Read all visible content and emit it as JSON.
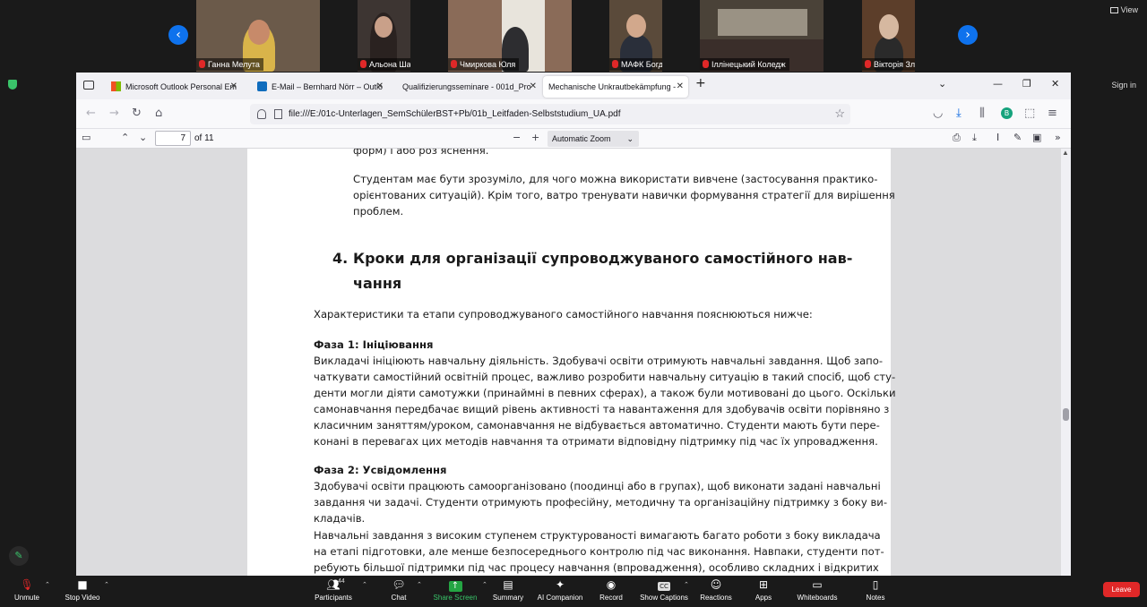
{
  "view_label": "View",
  "sign_in_label": "Sign in",
  "participants_strip": [
    {
      "name": "Ганна Мелута"
    },
    {
      "name": "Альона Шаповал"
    },
    {
      "name": "Чмиркова Юля"
    },
    {
      "name": "МАФК Богдан Борчук"
    },
    {
      "name": "Іллінецький Коледж"
    },
    {
      "name": "Вікторія Зленко"
    }
  ],
  "browser": {
    "tabs": [
      {
        "label": "Microsoft Outlook Personal Em"
      },
      {
        "label": "E-Mail – Bernhard Nörr – Outlo"
      },
      {
        "label": "Qualifizierungsseminare - 001d_Pro"
      },
      {
        "label": "Mechanische Unkrautbekämpfung -"
      }
    ],
    "url": "file:///E:/01c-Unterlagen_SemSchülerBST+Pb/01b_Leitfaden-Selbststudium_UA.pdf"
  },
  "pdf_toolbar": {
    "page_value": "7",
    "page_total": "of 11",
    "zoom": "Automatic Zoom"
  },
  "document": {
    "cut_top_line": "форм) і або роз’яснення.",
    "intro_para": [
      "Студентам має бути зрозуміло, для чого можна використати вивчене (застосування практико-",
      "орієнтованих ситуацій). Крім того, ватро тренувати навички формування стратегії для вирішення",
      "проблем."
    ],
    "heading_num": "4.",
    "heading_lines": [
      "Кроки для організації супроводжуваного самостійного нав-",
      "чання"
    ],
    "lead": "Характеристики та етапи супроводжуваного самостійного навчання пояснюються нижче:",
    "phase1_title": "Фаза 1: Ініціювання",
    "phase1_lines": [
      "Викладачі ініціюють навчальну діяльність. Здобувачі освіти отримують навчальні завдання. Щоб запо-",
      "чаткувати самостійний освітній процес, важливо розробити навчальну ситуацію в такий спосіб, щоб сту-",
      "денти могли діяти самотужки (принаймні в певних сферах), а також були мотивовані до цього. Оскільки",
      "самонавчання передбачає вищий рівень активності та навантаження для здобувачів освіти порівняно з",
      "класичним заняттям/уроком, самонавчання не відбувається автоматично. Студенти мають бути пере-",
      "конані в перевагах цих методів навчання та отримати відповідну підтримку під час їх упровадження."
    ],
    "phase2_title": "Фаза 2: Усвідомлення",
    "phase2_lines": [
      "Здобувачі освіти працюють самоорганізовано (поодинці або в групах), щоб виконати задані навчальні",
      "завдання чи задачі. Студенти отримують професійну, методичну та організаційну підтримку з боку ви-",
      "кладачів."
    ],
    "last_lines": [
      "Навчальні завдання з високим ступенем структурованості вимагають багато роботи з боку викладача",
      "на етапі підготовки, але менше безпосереднього контролю під час виконання. Навпаки, студенти пот-",
      "ребують більшої підтримки під час процесу навчання (впровадження), особливо складних і відкритих"
    ]
  },
  "zoom_toolbar": {
    "unmute": "Unmute",
    "stop_video": "Stop Video",
    "participants": "Participants",
    "participants_count": "44",
    "chat": "Chat",
    "share_screen": "Share Screen",
    "summary": "Summary",
    "ai_companion": "AI Companion",
    "record": "Record",
    "show_captions": "Show Captions",
    "reactions": "Reactions",
    "apps": "Apps",
    "whiteboards": "Whiteboards",
    "notes": "Notes",
    "leave": "Leave"
  }
}
